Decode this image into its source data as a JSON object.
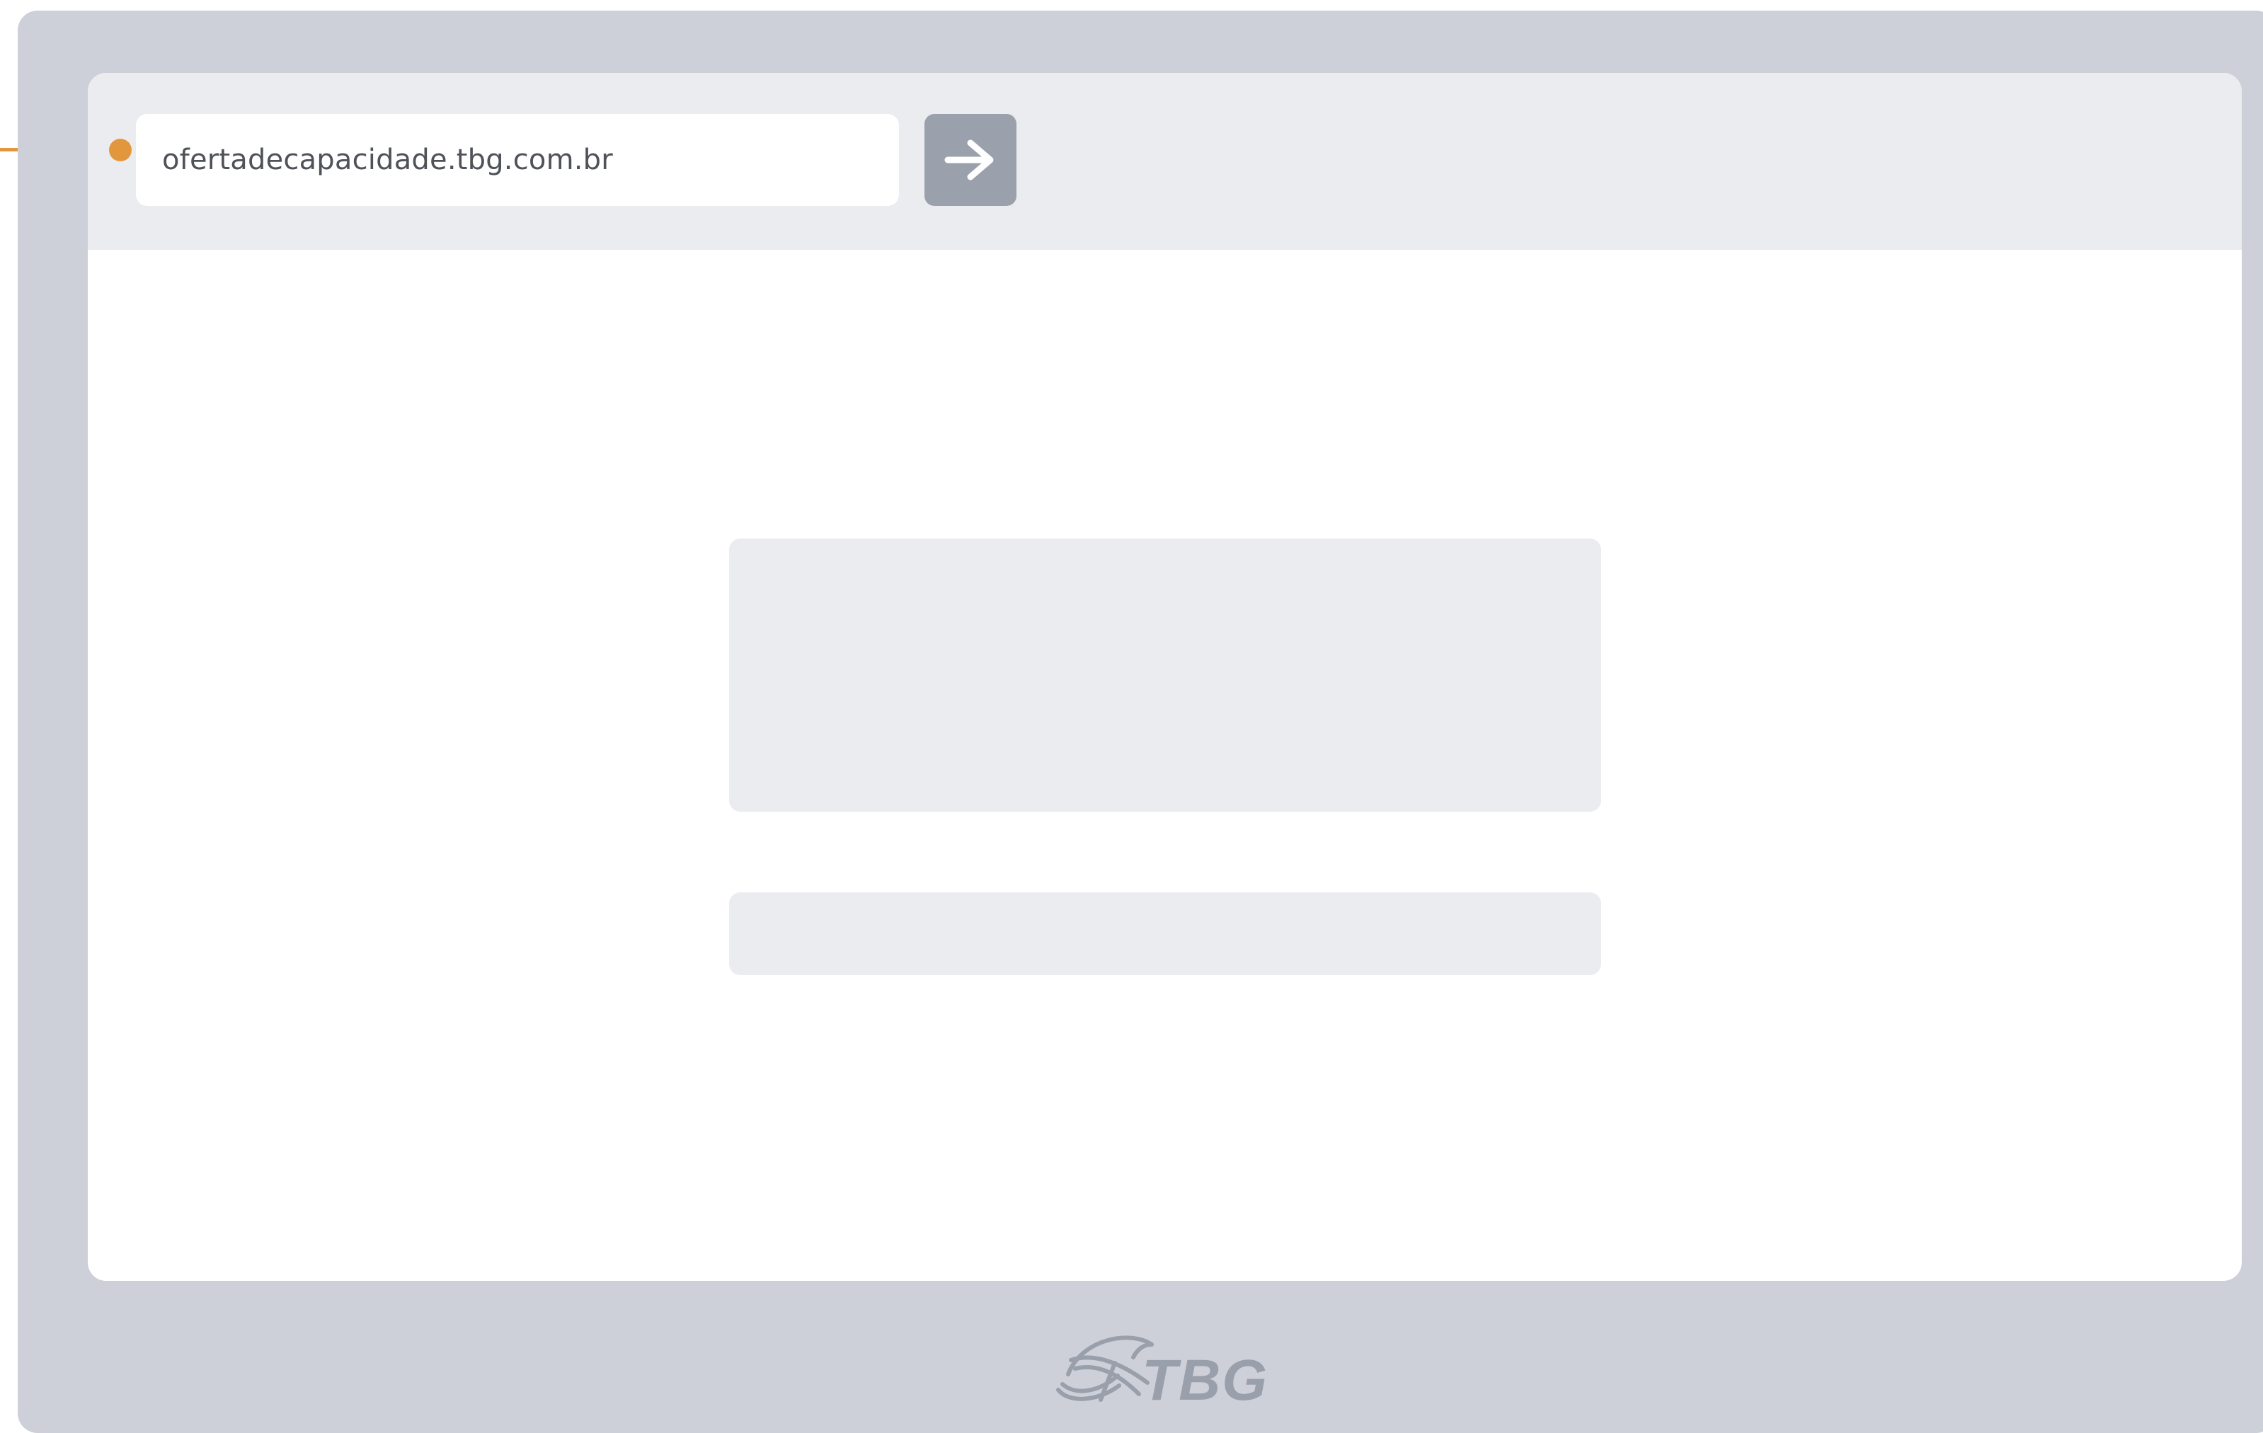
{
  "browser": {
    "address_value": "ofertadecapacidade.tbg.com.br",
    "go_icon": "arrow-right-icon"
  },
  "brand": {
    "logo_text": "TBG",
    "logo_icon": "tbg-logo-icon"
  },
  "colors": {
    "frame": "#cdd0d8",
    "bar": "#ebecef",
    "placeholder": "#ebecef",
    "button": "#9ba1ac",
    "callout": "#e3973d",
    "logo": "#9aa0ab"
  }
}
